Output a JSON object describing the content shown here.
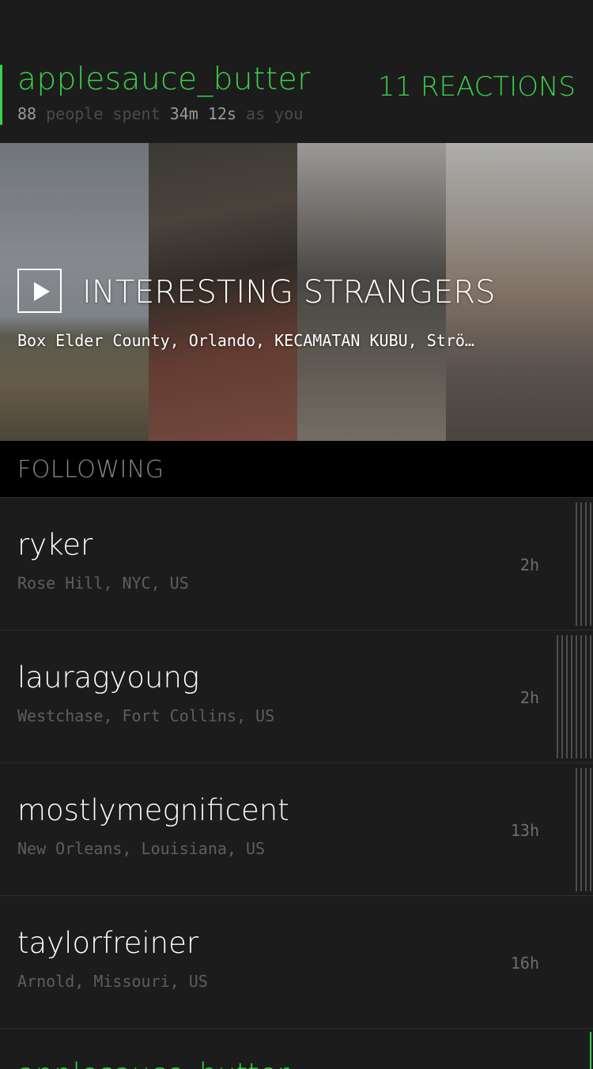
{
  "profile": {
    "username": "applesauce_butter",
    "stats": {
      "count": "88",
      "people_spent": "people spent",
      "duration": "34m 12s",
      "as_you": "as you"
    },
    "reactions": "11 REACTIONS"
  },
  "strangers": {
    "title": "INTERESTING STRANGERS",
    "places": "Box Elder County, Orlando, KECAMATAN KUBU, Strö…",
    "play_icon": "play-icon"
  },
  "following": {
    "label": "FOLLOWING",
    "items": [
      {
        "name": "ryker",
        "location": "Rose Hill, NYC, US",
        "time": "2h",
        "reactions_shown": 4
      },
      {
        "name": "lauragyoung",
        "location": "Westchase, Fort Collins, US",
        "time": "2h",
        "reactions_shown": 8
      },
      {
        "name": "mostlymegnificent",
        "location": "New Orleans, Louisiana, US",
        "time": "13h",
        "reactions_shown": 4
      },
      {
        "name": "taylorfreiner",
        "location": "Arnold, Missouri, US",
        "time": "16h",
        "reactions_shown": 0
      }
    ],
    "partial_name": "applesauce_butter"
  },
  "colors": {
    "accent": "#3bd14a",
    "background": "#1c1c1c",
    "header_bg": "#000000"
  }
}
